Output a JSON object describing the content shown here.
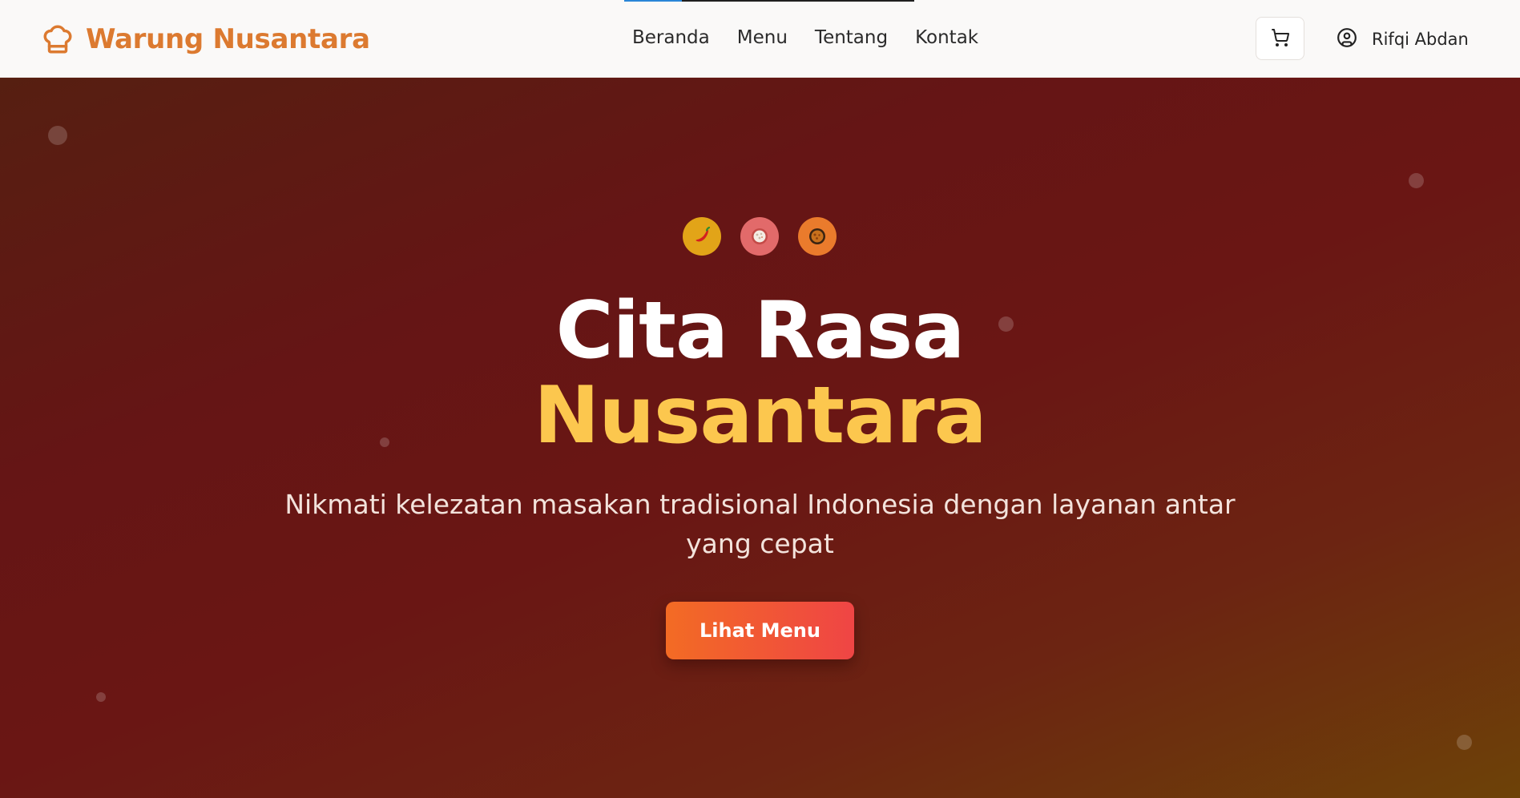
{
  "navbar": {
    "progress": 0.2,
    "brand": {
      "name": "Warung Nusantara",
      "icon": "chef-hat-icon",
      "color": "#dc7a30"
    },
    "links": [
      {
        "label": "Beranda"
      },
      {
        "label": "Menu"
      },
      {
        "label": "Tentang"
      },
      {
        "label": "Kontak"
      }
    ],
    "cart": {
      "icon": "shopping-cart-icon"
    },
    "user": {
      "icon": "user-circle-icon",
      "name": "Rifqi Abdan"
    }
  },
  "hero": {
    "icons": [
      {
        "name": "chili-pepper-icon",
        "bg": "#e2a418"
      },
      {
        "name": "rice-bowl-icon",
        "bg": "#e26a6a"
      },
      {
        "name": "fried-dish-icon",
        "bg": "#ea7b2c"
      }
    ],
    "title_line1": "Cita Rasa",
    "title_line2": "Nusantara",
    "subtitle": "Nikmati kelezatan masakan tradisional Indonesia dengan layanan antar yang cepat",
    "cta_label": "Lihat Menu",
    "colors": {
      "accent": "#fcc74e",
      "cta_start": "#f36b24",
      "cta_end": "#ef4545"
    }
  }
}
